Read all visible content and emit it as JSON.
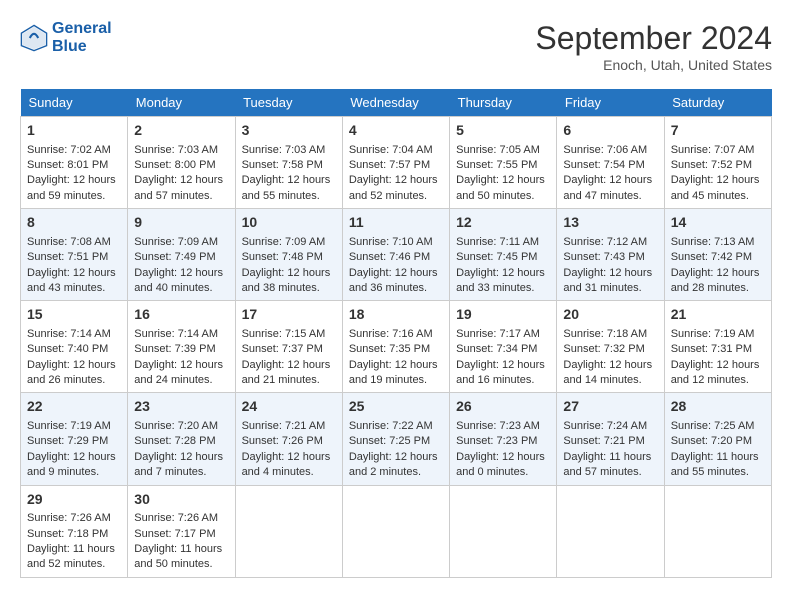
{
  "header": {
    "logo_line1": "General",
    "logo_line2": "Blue",
    "month": "September 2024",
    "location": "Enoch, Utah, United States"
  },
  "weekdays": [
    "Sunday",
    "Monday",
    "Tuesday",
    "Wednesday",
    "Thursday",
    "Friday",
    "Saturday"
  ],
  "weeks": [
    [
      {
        "day": "1",
        "lines": [
          "Sunrise: 7:02 AM",
          "Sunset: 8:01 PM",
          "Daylight: 12 hours",
          "and 59 minutes."
        ]
      },
      {
        "day": "2",
        "lines": [
          "Sunrise: 7:03 AM",
          "Sunset: 8:00 PM",
          "Daylight: 12 hours",
          "and 57 minutes."
        ]
      },
      {
        "day": "3",
        "lines": [
          "Sunrise: 7:03 AM",
          "Sunset: 7:58 PM",
          "Daylight: 12 hours",
          "and 55 minutes."
        ]
      },
      {
        "day": "4",
        "lines": [
          "Sunrise: 7:04 AM",
          "Sunset: 7:57 PM",
          "Daylight: 12 hours",
          "and 52 minutes."
        ]
      },
      {
        "day": "5",
        "lines": [
          "Sunrise: 7:05 AM",
          "Sunset: 7:55 PM",
          "Daylight: 12 hours",
          "and 50 minutes."
        ]
      },
      {
        "day": "6",
        "lines": [
          "Sunrise: 7:06 AM",
          "Sunset: 7:54 PM",
          "Daylight: 12 hours",
          "and 47 minutes."
        ]
      },
      {
        "day": "7",
        "lines": [
          "Sunrise: 7:07 AM",
          "Sunset: 7:52 PM",
          "Daylight: 12 hours",
          "and 45 minutes."
        ]
      }
    ],
    [
      {
        "day": "8",
        "lines": [
          "Sunrise: 7:08 AM",
          "Sunset: 7:51 PM",
          "Daylight: 12 hours",
          "and 43 minutes."
        ]
      },
      {
        "day": "9",
        "lines": [
          "Sunrise: 7:09 AM",
          "Sunset: 7:49 PM",
          "Daylight: 12 hours",
          "and 40 minutes."
        ]
      },
      {
        "day": "10",
        "lines": [
          "Sunrise: 7:09 AM",
          "Sunset: 7:48 PM",
          "Daylight: 12 hours",
          "and 38 minutes."
        ]
      },
      {
        "day": "11",
        "lines": [
          "Sunrise: 7:10 AM",
          "Sunset: 7:46 PM",
          "Daylight: 12 hours",
          "and 36 minutes."
        ]
      },
      {
        "day": "12",
        "lines": [
          "Sunrise: 7:11 AM",
          "Sunset: 7:45 PM",
          "Daylight: 12 hours",
          "and 33 minutes."
        ]
      },
      {
        "day": "13",
        "lines": [
          "Sunrise: 7:12 AM",
          "Sunset: 7:43 PM",
          "Daylight: 12 hours",
          "and 31 minutes."
        ]
      },
      {
        "day": "14",
        "lines": [
          "Sunrise: 7:13 AM",
          "Sunset: 7:42 PM",
          "Daylight: 12 hours",
          "and 28 minutes."
        ]
      }
    ],
    [
      {
        "day": "15",
        "lines": [
          "Sunrise: 7:14 AM",
          "Sunset: 7:40 PM",
          "Daylight: 12 hours",
          "and 26 minutes."
        ]
      },
      {
        "day": "16",
        "lines": [
          "Sunrise: 7:14 AM",
          "Sunset: 7:39 PM",
          "Daylight: 12 hours",
          "and 24 minutes."
        ]
      },
      {
        "day": "17",
        "lines": [
          "Sunrise: 7:15 AM",
          "Sunset: 7:37 PM",
          "Daylight: 12 hours",
          "and 21 minutes."
        ]
      },
      {
        "day": "18",
        "lines": [
          "Sunrise: 7:16 AM",
          "Sunset: 7:35 PM",
          "Daylight: 12 hours",
          "and 19 minutes."
        ]
      },
      {
        "day": "19",
        "lines": [
          "Sunrise: 7:17 AM",
          "Sunset: 7:34 PM",
          "Daylight: 12 hours",
          "and 16 minutes."
        ]
      },
      {
        "day": "20",
        "lines": [
          "Sunrise: 7:18 AM",
          "Sunset: 7:32 PM",
          "Daylight: 12 hours",
          "and 14 minutes."
        ]
      },
      {
        "day": "21",
        "lines": [
          "Sunrise: 7:19 AM",
          "Sunset: 7:31 PM",
          "Daylight: 12 hours",
          "and 12 minutes."
        ]
      }
    ],
    [
      {
        "day": "22",
        "lines": [
          "Sunrise: 7:19 AM",
          "Sunset: 7:29 PM",
          "Daylight: 12 hours",
          "and 9 minutes."
        ]
      },
      {
        "day": "23",
        "lines": [
          "Sunrise: 7:20 AM",
          "Sunset: 7:28 PM",
          "Daylight: 12 hours",
          "and 7 minutes."
        ]
      },
      {
        "day": "24",
        "lines": [
          "Sunrise: 7:21 AM",
          "Sunset: 7:26 PM",
          "Daylight: 12 hours",
          "and 4 minutes."
        ]
      },
      {
        "day": "25",
        "lines": [
          "Sunrise: 7:22 AM",
          "Sunset: 7:25 PM",
          "Daylight: 12 hours",
          "and 2 minutes."
        ]
      },
      {
        "day": "26",
        "lines": [
          "Sunrise: 7:23 AM",
          "Sunset: 7:23 PM",
          "Daylight: 12 hours",
          "and 0 minutes."
        ]
      },
      {
        "day": "27",
        "lines": [
          "Sunrise: 7:24 AM",
          "Sunset: 7:21 PM",
          "Daylight: 11 hours",
          "and 57 minutes."
        ]
      },
      {
        "day": "28",
        "lines": [
          "Sunrise: 7:25 AM",
          "Sunset: 7:20 PM",
          "Daylight: 11 hours",
          "and 55 minutes."
        ]
      }
    ],
    [
      {
        "day": "29",
        "lines": [
          "Sunrise: 7:26 AM",
          "Sunset: 7:18 PM",
          "Daylight: 11 hours",
          "and 52 minutes."
        ]
      },
      {
        "day": "30",
        "lines": [
          "Sunrise: 7:26 AM",
          "Sunset: 7:17 PM",
          "Daylight: 11 hours",
          "and 50 minutes."
        ]
      },
      {
        "day": "",
        "lines": [],
        "empty": true
      },
      {
        "day": "",
        "lines": [],
        "empty": true
      },
      {
        "day": "",
        "lines": [],
        "empty": true
      },
      {
        "day": "",
        "lines": [],
        "empty": true
      },
      {
        "day": "",
        "lines": [],
        "empty": true
      }
    ]
  ]
}
